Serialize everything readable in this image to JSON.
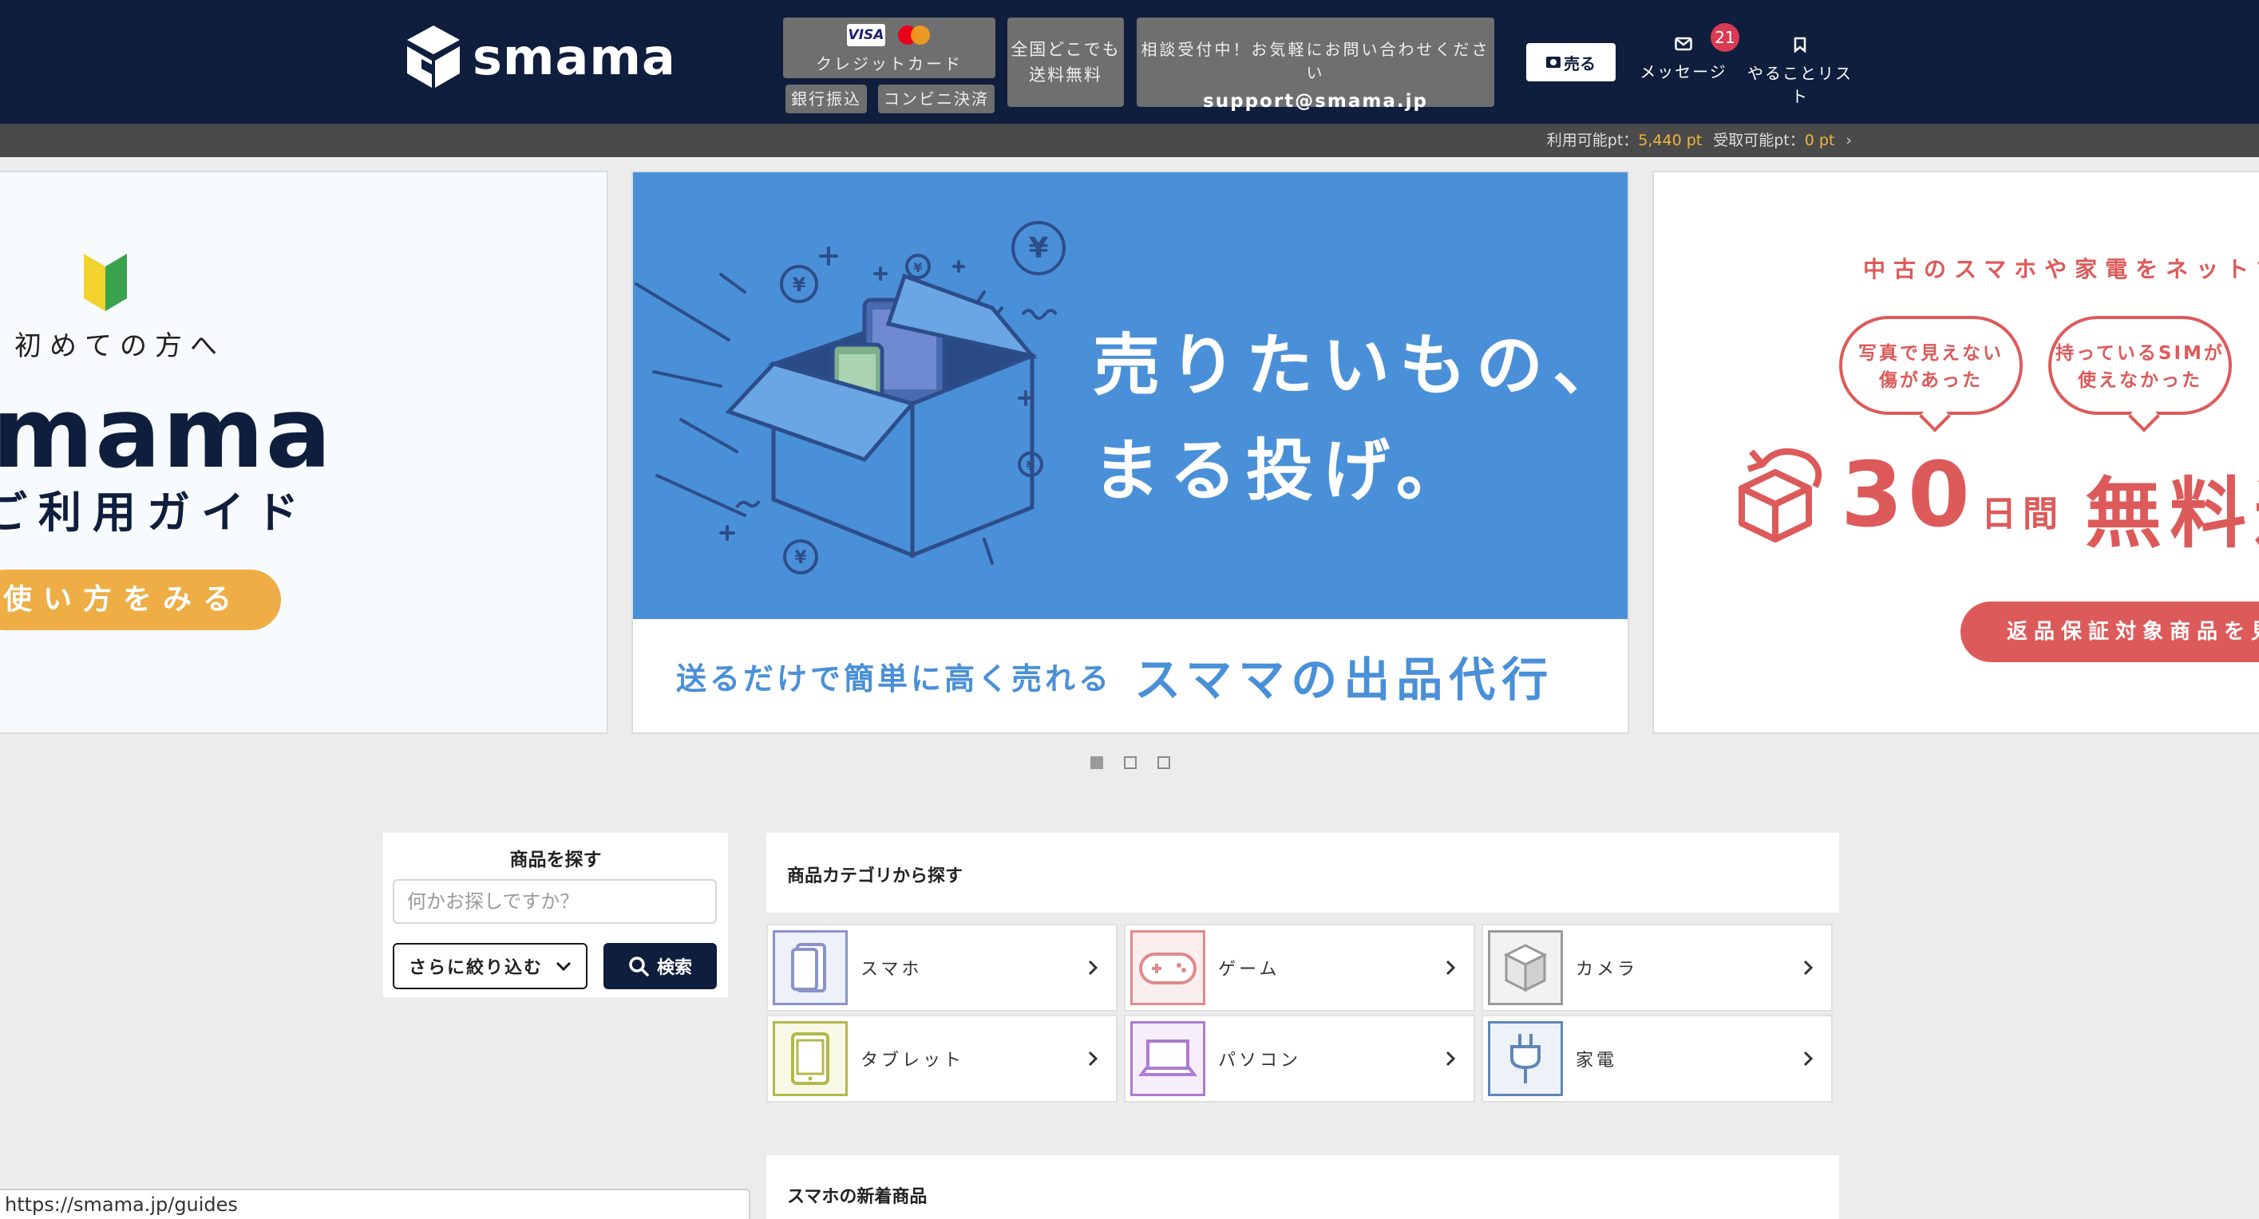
{
  "header": {
    "logo_text": "smama",
    "payment": {
      "card_label": "クレジットカード",
      "bank_label": "銀行振込",
      "convenience_label": "コンビニ決済",
      "visa_text": "VISA"
    },
    "shipping": {
      "line1": "全国どこでも",
      "line2": "送料無料"
    },
    "contact": {
      "line1": "相談受付中！お気軽にお問い合わせください",
      "email": "support@smama.jp"
    },
    "sell_label": "売る",
    "messages_label": "メッセージ",
    "messages_badge": "21",
    "todo_label": "やることリスト"
  },
  "points": {
    "usable_label": "利用可能pt：",
    "usable_value": "5,440 pt",
    "receivable_label": "受取可能pt：",
    "receivable_value": "0 pt"
  },
  "carousel": {
    "left": {
      "first_time": "初めての方へ",
      "brand": "mama",
      "title": "ご利用ガイド",
      "button": "使い方をみる"
    },
    "center": {
      "headline_line1": "売りたいもの、",
      "headline_line2": "まる投げ。",
      "sub_small": "送るだけで簡単に高く売れる",
      "sub_large": "スママの出品代行"
    },
    "right": {
      "headline": "中古のスマホや家電をネットで買",
      "bubble1_line1": "写真で見えない",
      "bubble1_line2": "傷があった",
      "bubble2_line1": "持っているSIMが",
      "bubble2_line2": "使えなかった",
      "days_number": "30",
      "days_label": "日間",
      "free_label": "無料返",
      "button": "返品保証対象商品を見"
    },
    "active_index": 0,
    "count": 3
  },
  "search": {
    "title": "商品を探す",
    "placeholder": "何かお探しですか？",
    "filter_label": "さらに絞り込む",
    "search_label": "検索"
  },
  "categories": {
    "title": "商品カテゴリから探す",
    "items": [
      {
        "label": "スマホ",
        "icon": "smartphone-icon",
        "color": "#8a93c8"
      },
      {
        "label": "ゲーム",
        "icon": "gamepad-icon",
        "color": "#e08a8a"
      },
      {
        "label": "カメラ",
        "icon": "camera-box-icon",
        "color": "#9a9a9a"
      },
      {
        "label": "タブレット",
        "icon": "tablet-icon",
        "color": "#b3b84a"
      },
      {
        "label": "パソコン",
        "icon": "laptop-icon",
        "color": "#b07ad0"
      },
      {
        "label": "家電",
        "icon": "plug-icon",
        "color": "#5f86b8"
      }
    ]
  },
  "new_arrivals": {
    "title": "スマホの新着商品"
  },
  "status_url": "https://smama.jp/guides"
}
